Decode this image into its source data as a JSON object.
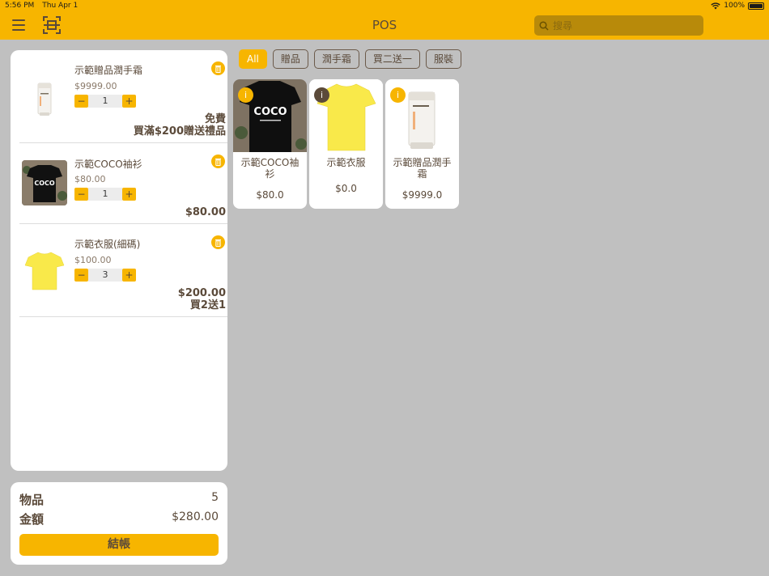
{
  "status_bar": {
    "time": "5:56 PM",
    "date": "Thu Apr 1",
    "battery": "100%"
  },
  "nav": {
    "title": "POS",
    "search_placeholder": "搜尋"
  },
  "cart": {
    "items": [
      {
        "name": "示範贈品潤手霜",
        "price": "$9999.00",
        "qty": "1",
        "line_total": "免費",
        "note": "買滿$200贈送禮品",
        "image": "hand-cream"
      },
      {
        "name": "示範COCO袖衫",
        "price": "$80.00",
        "qty": "1",
        "line_total": "$80.00",
        "note": "",
        "image": "black-tshirt"
      },
      {
        "name": "示範衣服(細碼)",
        "price": "$100.00",
        "qty": "3",
        "line_total": "$200.00",
        "note": "買2送1",
        "image": "yellow-tshirt"
      }
    ]
  },
  "summary": {
    "items_label": "物品",
    "items_count": "5",
    "total_label": "金額",
    "total_value": "$280.00",
    "checkout_label": "結帳"
  },
  "filters": [
    {
      "label": "All",
      "active": true
    },
    {
      "label": "贈品",
      "active": false
    },
    {
      "label": "潤手霜",
      "active": false
    },
    {
      "label": "買二送一",
      "active": false
    },
    {
      "label": "服裝",
      "active": false
    }
  ],
  "products": [
    {
      "name": "示範COCO袖衫",
      "price": "$80.0",
      "image": "black-tshirt"
    },
    {
      "name": "示範衣服",
      "price": "$0.0",
      "image": "yellow-tshirt"
    },
    {
      "name": "示範贈品潤手霜",
      "price": "$9999.0",
      "image": "hand-cream"
    }
  ],
  "colors": {
    "accent": "#f7b500",
    "text": "#5b4a3a",
    "background": "#c0c0c0",
    "panel": "#ffffff"
  }
}
